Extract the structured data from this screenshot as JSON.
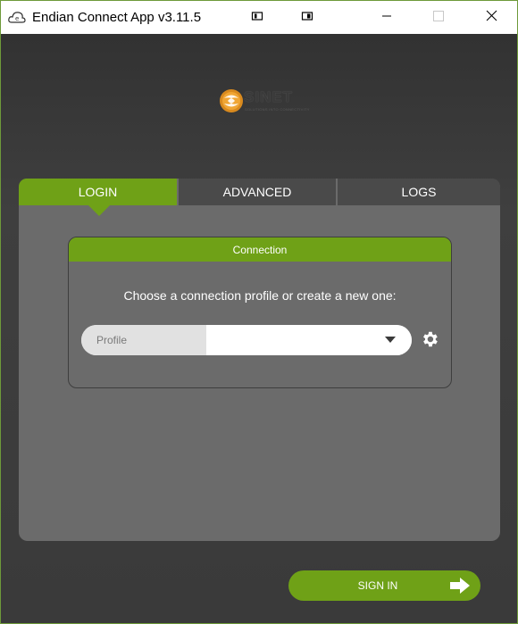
{
  "window": {
    "title": "Endian Connect App v3.11.5"
  },
  "logo": {
    "text": "SINET",
    "tagline": "SOLUTIONS INTO CONNECTIVITY"
  },
  "tabs": [
    {
      "label": "LOGIN",
      "active": true
    },
    {
      "label": "ADVANCED",
      "active": false
    },
    {
      "label": "LOGS",
      "active": false
    }
  ],
  "connection": {
    "header": "Connection",
    "prompt": "Choose a connection profile or create a new one:",
    "profile_label": "Profile",
    "profile_value": ""
  },
  "actions": {
    "sign_in_label": "SIGN IN"
  },
  "colors": {
    "accent": "#6fa117",
    "panel": "#6b6b6b",
    "background": "#3b3b3b",
    "tab_inactive": "#4a4a4a"
  },
  "icons": {
    "app": "endian-cloud-icon",
    "settings": "gear-icon",
    "sign_in": "arrow-right-icon",
    "profile_dropdown": "caret-down-icon"
  }
}
